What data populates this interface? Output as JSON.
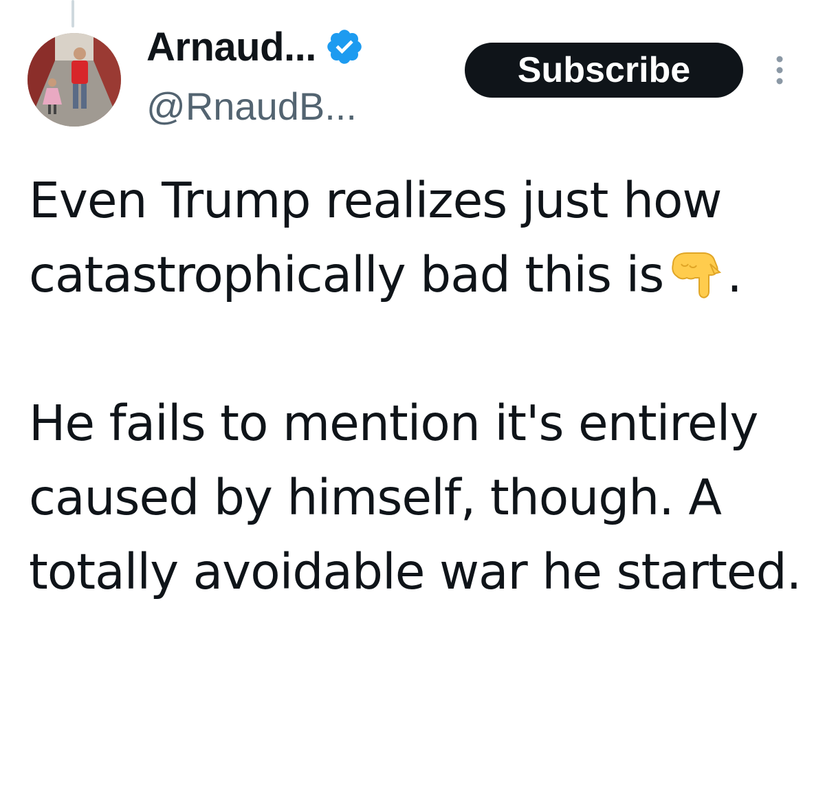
{
  "author": {
    "display_name": "Arnaud...",
    "handle": "@RnaudB...",
    "verified": true,
    "verified_color": "#1d9bf0",
    "avatar_icon": "avatar-photo"
  },
  "actions": {
    "subscribe_label": "Subscribe",
    "more_icon": "more-vertical-icon"
  },
  "tweet": {
    "line1_text": "Even Trump realizes just how catastrophically bad this is",
    "line1_emoji": "backhand-index-pointing-down-emoji",
    "line1_end": ".",
    "paragraph2": "He fails to mention it's entirely caused by himself, though. A totally avoidable war he started."
  },
  "colors": {
    "text": "#0f1419",
    "secondary_text": "#536471",
    "button_bg": "#0f1419",
    "button_text": "#ffffff"
  }
}
